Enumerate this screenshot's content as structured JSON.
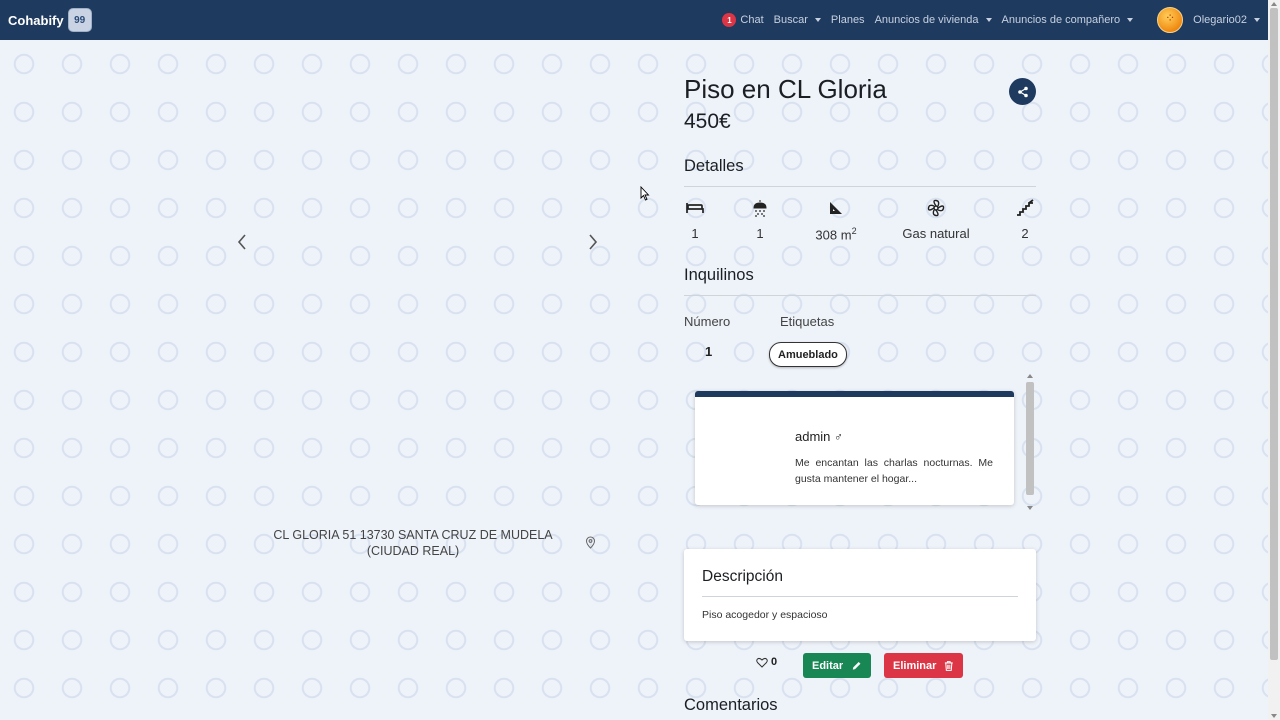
{
  "navbar": {
    "brand": "Cohabify",
    "brand_logo_text": "99",
    "chat_badge": "1",
    "chat": "Chat",
    "buscar": "Buscar",
    "planes": "Planes",
    "anuncios_vivienda": "Anuncios de vivienda",
    "anuncios_companero": "Anuncios de compañero",
    "username": "Olegario02"
  },
  "listing": {
    "title": "Piso en CL Gloria",
    "price": "450€",
    "address": "CL GLORIA 51 13730 SANTA CRUZ DE MUDELA (CIUDAD REAL)"
  },
  "details": {
    "heading": "Detalles",
    "items": [
      {
        "icon": "bed-icon",
        "value": "1"
      },
      {
        "icon": "shower-icon",
        "value": "1"
      },
      {
        "icon": "area-icon",
        "value": "308 m",
        "sup": "2"
      },
      {
        "icon": "fan-icon",
        "value": "Gas natural"
      },
      {
        "icon": "stairs-icon",
        "value": "2"
      }
    ]
  },
  "tenants": {
    "heading": "Inquilinos",
    "number_label": "Número",
    "tags_label": "Etiquetas",
    "number": "1",
    "tag": "Amueblado",
    "card": {
      "name": "admin",
      "gender_symbol": "♂",
      "description": "Me encantan las charlas nocturnas. Me gusta mantener el hogar..."
    }
  },
  "description": {
    "heading": "Descripción",
    "text": "Piso acogedor y espacioso"
  },
  "actions": {
    "likes": "0",
    "edit": "Editar",
    "delete": "Eliminar"
  },
  "comments": {
    "heading": "Comentarios"
  },
  "colors": {
    "navbar": "#1f3a5f",
    "edit": "#198754",
    "delete": "#dc3545"
  }
}
